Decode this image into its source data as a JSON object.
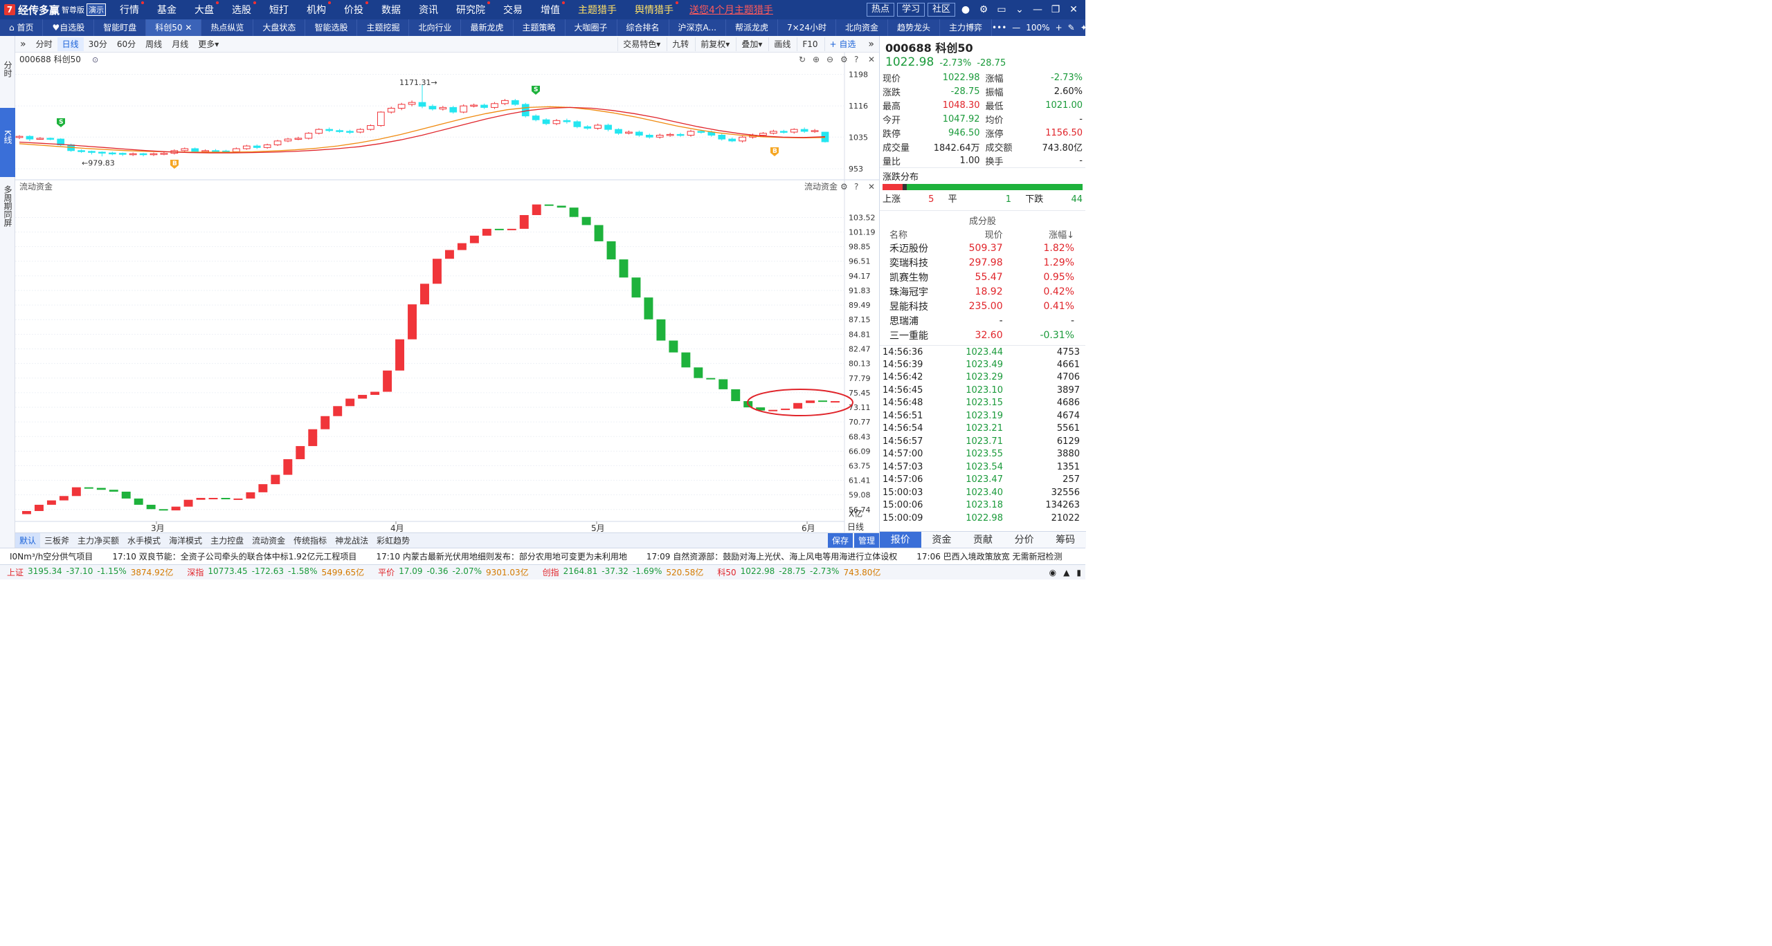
{
  "app": {
    "logo_mark": "7",
    "name": "经传多赢",
    "edition": "智尊版",
    "demo_label": "演示"
  },
  "menu": [
    {
      "label": "行情",
      "dot": true
    },
    {
      "label": "基金",
      "dot": false
    },
    {
      "label": "大盘",
      "dot": true
    },
    {
      "label": "选股",
      "dot": true
    },
    {
      "label": "短打",
      "dot": false
    },
    {
      "label": "机构",
      "dot": true
    },
    {
      "label": "价投",
      "dot": true
    },
    {
      "label": "数据",
      "dot": false
    },
    {
      "label": "资讯",
      "dot": false
    },
    {
      "label": "研究院",
      "dot": true
    },
    {
      "label": "交易",
      "dot": false
    },
    {
      "label": "增值",
      "dot": true
    },
    {
      "label": "主题猎手",
      "dot": false,
      "gold": true
    },
    {
      "label": "舆情猎手",
      "dot": true,
      "gold": true
    }
  ],
  "promo": "送您4个月主题猎手",
  "top_buttons": [
    "热点",
    "学习",
    "社区"
  ],
  "top_icons": [
    "user-icon",
    "gear-icon",
    "window-icon",
    "chevron-down-icon",
    "minimize-icon",
    "restore-icon",
    "close-icon"
  ],
  "tabs": [
    "首页",
    "自选股",
    "智能盯盘",
    "科创50",
    "热点纵览",
    "大盘状态",
    "智能选股",
    "主题挖掘",
    "北向行业",
    "最新龙虎",
    "主题策略",
    "大咖圈子",
    "综合排名",
    "沪深京A...",
    "帮派龙虎",
    "7×24小时",
    "北向资金",
    "趋势龙头",
    "主力博弈"
  ],
  "active_tab": 3,
  "tab_tail": {
    "zoom": "100%",
    "more": "•••",
    "minus": "—",
    "plus": "+"
  },
  "leftnav": [
    "分时",
    "K线",
    "多周期同屏"
  ],
  "chart_toolbar": {
    "periods": [
      "分时",
      "日线",
      "30分",
      "60分",
      "周线",
      "月线",
      "更多"
    ],
    "active": 1,
    "right": [
      "交易特色",
      "九转",
      "前复权",
      "叠加",
      "画线",
      "F10",
      "+ 自选"
    ]
  },
  "price_pane": {
    "title": "000688 科创50",
    "axis_labels": [
      "1198",
      "1116",
      "1035",
      "953"
    ],
    "hi_label": "1171.31→",
    "lo_label": "←979.83"
  },
  "flow_pane": {
    "title": "流动资金",
    "title_right": "流动资金",
    "axis_labels": [
      "103.52",
      "101.19",
      "98.85",
      "96.51",
      "94.17",
      "91.83",
      "89.49",
      "87.15",
      "84.81",
      "82.47",
      "80.13",
      "77.79",
      "75.45",
      "73.11",
      "70.77",
      "68.43",
      "66.09",
      "63.75",
      "61.41",
      "59.08",
      "56.74"
    ],
    "unit": "X亿",
    "period": "日线"
  },
  "x_labels": [
    "3月",
    "4月",
    "5月",
    "6月"
  ],
  "chart_data": [
    {
      "type": "candlestick",
      "title": "000688 科创50",
      "y_ticks": [
        953,
        1035,
        1116,
        1198
      ],
      "x_ticks": [
        "3月",
        "4月",
        "5月",
        "6月"
      ],
      "annotations": [
        {
          "text": "1171.31→",
          "note": "high"
        },
        {
          "text": "←979.83",
          "note": "low"
        },
        {
          "text": "S",
          "kind": "sell"
        },
        {
          "text": "S",
          "kind": "sell"
        },
        {
          "text": "B",
          "kind": "buy"
        },
        {
          "text": "B",
          "kind": "buy"
        }
      ],
      "candles": [
        [
          1034,
          1037,
          1040,
          1030
        ],
        [
          1037,
          1030,
          1040,
          1025
        ],
        [
          1030,
          1032,
          1035,
          1028
        ],
        [
          1032,
          1030,
          1034,
          1027
        ],
        [
          1030,
          1015,
          1032,
          1012
        ],
        [
          1015,
          1000,
          1018,
          997
        ],
        [
          1000,
          998,
          1003,
          994
        ],
        [
          998,
          996,
          1000,
          990
        ],
        [
          996,
          994,
          998,
          985
        ],
        [
          994,
          993,
          997,
          988
        ],
        [
          993,
          991,
          995,
          986
        ],
        [
          991,
          992,
          995,
          986
        ],
        [
          992,
          990,
          994,
          985
        ],
        [
          990,
          992,
          995,
          986
        ],
        [
          992,
          993,
          996,
          988
        ],
        [
          993,
          1000,
          1003,
          990
        ],
        [
          1000,
          1005,
          1008,
          997
        ],
        [
          1005,
          998,
          1008,
          994
        ],
        [
          998,
          1000,
          1003,
          995
        ],
        [
          1000,
          999,
          1004,
          995
        ],
        [
          999,
          997,
          1002,
          994
        ],
        [
          997,
          1005,
          1008,
          994
        ],
        [
          1005,
          1012,
          1015,
          1002
        ],
        [
          1012,
          1008,
          1016,
          1004
        ],
        [
          1008,
          1015,
          1018,
          1005
        ],
        [
          1015,
          1025,
          1028,
          1012
        ],
        [
          1025,
          1030,
          1033,
          1022
        ],
        [
          1030,
          1032,
          1036,
          1027
        ],
        [
          1032,
          1045,
          1048,
          1029
        ],
        [
          1045,
          1055,
          1058,
          1042
        ],
        [
          1055,
          1052,
          1060,
          1048
        ],
        [
          1052,
          1050,
          1056,
          1046
        ],
        [
          1050,
          1048,
          1054,
          1043
        ],
        [
          1048,
          1055,
          1058,
          1045
        ],
        [
          1055,
          1065,
          1068,
          1052
        ],
        [
          1065,
          1100,
          1102,
          1062
        ],
        [
          1100,
          1110,
          1114,
          1096
        ],
        [
          1110,
          1120,
          1124,
          1105
        ],
        [
          1120,
          1125,
          1130,
          1115
        ],
        [
          1125,
          1115,
          1171,
          1110
        ],
        [
          1115,
          1108,
          1120,
          1104
        ],
        [
          1108,
          1112,
          1116,
          1104
        ],
        [
          1112,
          1100,
          1116,
          1096
        ],
        [
          1100,
          1116,
          1120,
          1097
        ],
        [
          1116,
          1118,
          1122,
          1112
        ],
        [
          1118,
          1112,
          1122,
          1108
        ],
        [
          1112,
          1122,
          1126,
          1108
        ],
        [
          1122,
          1130,
          1134,
          1118
        ],
        [
          1130,
          1120,
          1134,
          1116
        ],
        [
          1120,
          1090,
          1124,
          1086
        ],
        [
          1090,
          1080,
          1094,
          1076
        ],
        [
          1080,
          1070,
          1084,
          1066
        ],
        [
          1070,
          1078,
          1082,
          1066
        ],
        [
          1078,
          1075,
          1083,
          1070
        ],
        [
          1075,
          1062,
          1079,
          1058
        ],
        [
          1062,
          1058,
          1066,
          1054
        ],
        [
          1058,
          1066,
          1070,
          1054
        ],
        [
          1066,
          1055,
          1070,
          1050
        ],
        [
          1055,
          1045,
          1058,
          1041
        ],
        [
          1045,
          1048,
          1052,
          1042
        ],
        [
          1048,
          1040,
          1052,
          1036
        ],
        [
          1040,
          1035,
          1044,
          1031
        ],
        [
          1035,
          1040,
          1044,
          1031
        ],
        [
          1040,
          1042,
          1046,
          1036
        ],
        [
          1042,
          1040,
          1046,
          1036
        ],
        [
          1040,
          1050,
          1054,
          1036
        ],
        [
          1050,
          1048,
          1054,
          1044
        ],
        [
          1048,
          1040,
          1052,
          1036
        ],
        [
          1040,
          1030,
          1044,
          1026
        ],
        [
          1030,
          1025,
          1034,
          1022
        ],
        [
          1025,
          1035,
          1038,
          1021
        ],
        [
          1035,
          1040,
          1044,
          1031
        ],
        [
          1040,
          1045,
          1048,
          1036
        ],
        [
          1045,
          1050,
          1054,
          1042
        ],
        [
          1050,
          1048,
          1054,
          1044
        ],
        [
          1048,
          1055,
          1058,
          1044
        ],
        [
          1055,
          1050,
          1060,
          1046
        ],
        [
          1050,
          1052,
          1056,
          1046
        ],
        [
          1047.92,
          1022.98,
          1048.3,
          1021.0
        ]
      ],
      "ma_series": [
        {
          "color": "#f08a0f",
          "values": [
            1018,
            1014,
            1010,
            1006,
            1003,
            1000,
            998,
            997,
            996,
            996,
            996,
            997,
            999,
            1002,
            1006,
            1012,
            1020,
            1030,
            1042,
            1056,
            1070,
            1084,
            1096,
            1106,
            1112,
            1114,
            1112,
            1106,
            1098,
            1088,
            1076,
            1064,
            1054,
            1046,
            1040,
            1036,
            1034,
            1033,
            1034
          ]
        },
        {
          "color": "#e0242a",
          "values": [
            1022,
            1019,
            1016,
            1012,
            1008,
            1004,
            1000,
            997,
            995,
            994,
            994,
            995,
            996,
            998,
            1001,
            1005,
            1010,
            1018,
            1028,
            1040,
            1054,
            1068,
            1082,
            1094,
            1104,
            1110,
            1112,
            1110,
            1104,
            1096,
            1086,
            1074,
            1062,
            1052,
            1044,
            1038,
            1035,
            1034,
            1036
          ]
        }
      ]
    },
    {
      "type": "bar",
      "title": "流动资金",
      "unit": "X亿",
      "y_ticks": [
        56.74,
        59.08,
        61.41,
        63.75,
        66.09,
        68.43,
        70.77,
        73.11,
        75.45,
        77.79,
        80.13,
        82.47,
        84.81,
        87.15,
        89.49,
        91.83,
        94.17,
        96.51,
        98.85,
        101.19,
        103.52
      ],
      "values": [
        56.5,
        57.5,
        58.2,
        58.9,
        60.3,
        60.2,
        59.9,
        59.6,
        58.5,
        57.5,
        56.8,
        56.6,
        57.2,
        58.3,
        58.6,
        58.6,
        58.4,
        58.5,
        59.5,
        60.8,
        62.3,
        64.8,
        66.9,
        69.6,
        71.7,
        73.3,
        74.5,
        75.1,
        75.6,
        79.0,
        84.0,
        89.6,
        92.9,
        96.9,
        98.3,
        99.4,
        100.6,
        101.7,
        101.5,
        101.7,
        103.9,
        105.6,
        105.4,
        105.1,
        103.6,
        102.3,
        99.7,
        96.8,
        93.9,
        90.7,
        87.2,
        83.8,
        81.9,
        79.5,
        77.8,
        77.6,
        76.0,
        74.1,
        73.1,
        72.6,
        72.7,
        72.9,
        73.8,
        74.2,
        74.1,
        74.1
      ]
    }
  ],
  "quote": {
    "code": "000688",
    "name": "科创50",
    "price": "1022.98",
    "change": "-28.75",
    "pct": "-2.73%",
    "rows": [
      [
        "现价",
        "1022.98",
        "涨幅",
        "-2.73%"
      ],
      [
        "涨跌",
        "-28.75",
        "振幅",
        "2.60%"
      ],
      [
        "最高",
        "1048.30",
        "最低",
        "1021.00"
      ],
      [
        "今开",
        "1047.92",
        "均价",
        "-"
      ],
      [
        "跌停",
        "946.50",
        "涨停",
        "1156.50"
      ],
      [
        "成交量",
        "1842.64万",
        "成交额",
        "743.80亿"
      ],
      [
        "量比",
        "1.00",
        "换手",
        "-"
      ]
    ]
  },
  "dist": {
    "title": "涨跌分布",
    "up_label": "上涨",
    "up": "5",
    "flat_label": "平",
    "flat": "1",
    "down_label": "下跌",
    "down": "44"
  },
  "components": {
    "title": "成分股",
    "headers": [
      "名称",
      "现价",
      "涨幅↓"
    ],
    "rows": [
      [
        "禾迈股份",
        "509.37",
        "1.82%"
      ],
      [
        "奕瑞科技",
        "297.98",
        "1.29%"
      ],
      [
        "凯赛生物",
        "55.47",
        "0.95%"
      ],
      [
        "珠海冠宇",
        "18.92",
        "0.42%"
      ],
      [
        "昱能科技",
        "235.00",
        "0.41%"
      ],
      [
        "思瑞浦",
        "-",
        "-"
      ],
      [
        "三一重能",
        "32.60",
        "-0.31%"
      ]
    ]
  },
  "ticks": [
    [
      "14:56:36",
      "1023.44",
      "4753"
    ],
    [
      "14:56:39",
      "1023.49",
      "4661"
    ],
    [
      "14:56:42",
      "1023.29",
      "4706"
    ],
    [
      "14:56:45",
      "1023.10",
      "3897"
    ],
    [
      "14:56:48",
      "1023.15",
      "4686"
    ],
    [
      "14:56:51",
      "1023.19",
      "4674"
    ],
    [
      "14:56:54",
      "1023.21",
      "5561"
    ],
    [
      "14:56:57",
      "1023.71",
      "6129"
    ],
    [
      "14:57:00",
      "1023.55",
      "3880"
    ],
    [
      "14:57:03",
      "1023.54",
      "1351"
    ],
    [
      "14:57:06",
      "1023.47",
      "257"
    ],
    [
      "15:00:03",
      "1023.40",
      "32556"
    ],
    [
      "15:00:06",
      "1023.18",
      "134263"
    ],
    [
      "15:00:09",
      "1022.98",
      "21022"
    ]
  ],
  "right_tabs": [
    "报价",
    "资金",
    "贡献",
    "分价",
    "筹码"
  ],
  "bottom_tabs": [
    "默认",
    "三板斧",
    "主力净买额",
    "水手模式",
    "海洋模式",
    "主力控盘",
    "流动资金",
    "传统指标",
    "神龙战法",
    "彩虹趋势"
  ],
  "bottom_right": [
    "保存",
    "管理"
  ],
  "news": [
    "I0Nm³/h空分供气项目",
    "17:10 双良节能：全资子公司牵头的联合体中标1.92亿元工程项目",
    "17:10 内蒙古最新光伏用地细则发布：部分农用地可变更为未利用地",
    "17:09 自然资源部：鼓励对海上光伏、海上风电等用海进行立体设权",
    "17:06 巴西入境政策放宽 无需新冠检测"
  ],
  "indices": [
    {
      "name": "上证",
      "value": "3195.34",
      "chg": "-37.10",
      "pct": "-1.15%",
      "amt": "3874.92亿"
    },
    {
      "name": "深指",
      "value": "10773.45",
      "chg": "-172.63",
      "pct": "-1.58%",
      "amt": "5499.65亿"
    },
    {
      "name": "平价",
      "value": "17.09",
      "chg": "-0.36",
      "pct": "-2.07%",
      "amt": "9301.03亿"
    },
    {
      "name": "创指",
      "value": "2164.81",
      "chg": "-37.32",
      "pct": "-1.69%",
      "amt": "520.58亿"
    },
    {
      "name": "科50",
      "value": "1022.98",
      "chg": "-28.75",
      "pct": "-2.73%",
      "amt": "743.80亿"
    }
  ],
  "colors": {
    "up": "#f0353a",
    "down": "#1eb23c",
    "down_kline": "#24e6f0",
    "ma1": "#f08a0f",
    "ma2": "#e0242a",
    "header": "#1a3e8c"
  }
}
